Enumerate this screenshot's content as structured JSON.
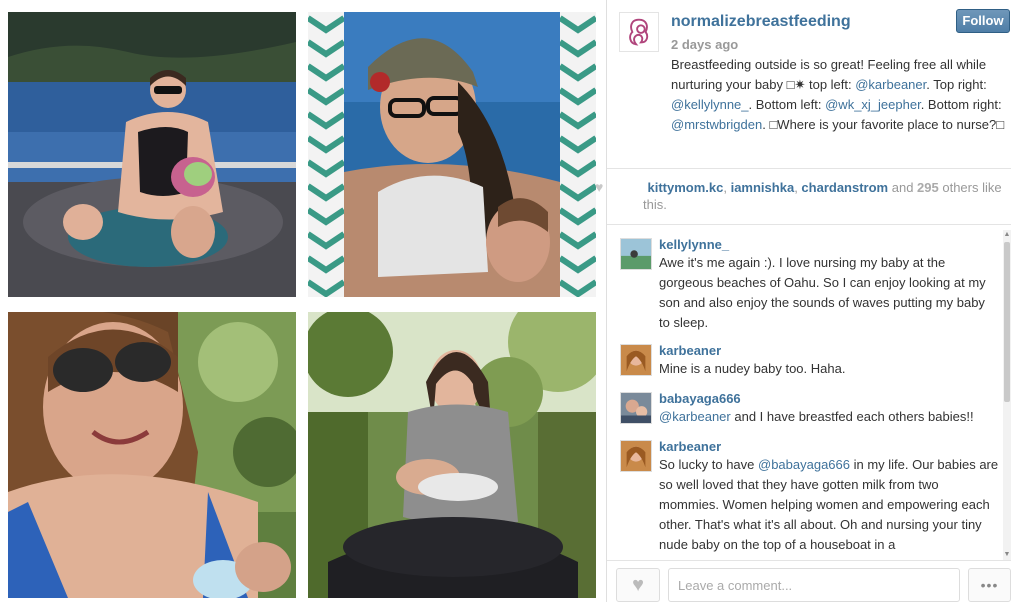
{
  "post": {
    "owner": "normalizebreastfeeding",
    "time": "2 days ago",
    "follow_label": "Follow",
    "caption_parts": [
      {
        "text": "Breastfeeding outside is so great! Feeling free all while nurturing your baby ",
        "tag": false
      },
      {
        "text": "□✷ top left: ",
        "tag": false
      },
      {
        "text": "@karbeaner",
        "tag": true
      },
      {
        "text": ". Top right: ",
        "tag": false
      },
      {
        "text": "@kellylynne_",
        "tag": true
      },
      {
        "text": ". Bottom left: ",
        "tag": false
      },
      {
        "text": "@wk_xj_jeepher",
        "tag": true
      },
      {
        "text": ". Bottom right: ",
        "tag": false
      },
      {
        "text": "@mrstwbrigden",
        "tag": true
      },
      {
        "text": ". □Where is your favorite place to nurse?□",
        "tag": false
      }
    ]
  },
  "likes": {
    "heart_icon": "heart-icon",
    "users": [
      "kittymom.kc",
      "iamnishka",
      "chardanstrom"
    ],
    "sep": ", ",
    "and": " and ",
    "count": "295",
    "suffix": " others like this."
  },
  "comments": [
    {
      "user": "kellylynne_",
      "parts": [
        {
          "text": "Awe it's me again :). I love nursing my baby at the gorgeous beaches of Oahu. So I can enjoy looking at my son and also enjoy the sounds of waves putting my baby to sleep.",
          "tag": false
        }
      ]
    },
    {
      "user": "karbeaner",
      "parts": [
        {
          "text": "Mine is a nudey baby too. Haha.",
          "tag": false
        }
      ]
    },
    {
      "user": "babayaga666",
      "parts": [
        {
          "text": "@karbeaner",
          "tag": true
        },
        {
          "text": " and I have breastfed each others babies!!",
          "tag": false
        }
      ]
    },
    {
      "user": "karbeaner",
      "parts": [
        {
          "text": "So lucky to have ",
          "tag": false
        },
        {
          "text": "@babayaga666",
          "tag": true
        },
        {
          "text": " in my life. Our babies are so well loved that they have gotten milk from two mommies. Women helping women and empowering each other. That's what it's all about. Oh and nursing your tiny nude baby on the top of a houseboat in a",
          "tag": false
        }
      ]
    }
  ],
  "footer": {
    "comment_placeholder": "Leave a comment...",
    "like_icon": "heart-icon",
    "more_label": "•••"
  },
  "colors": {
    "link": "#3f729b",
    "follow_button": "#517fa4",
    "muted": "#999999"
  }
}
